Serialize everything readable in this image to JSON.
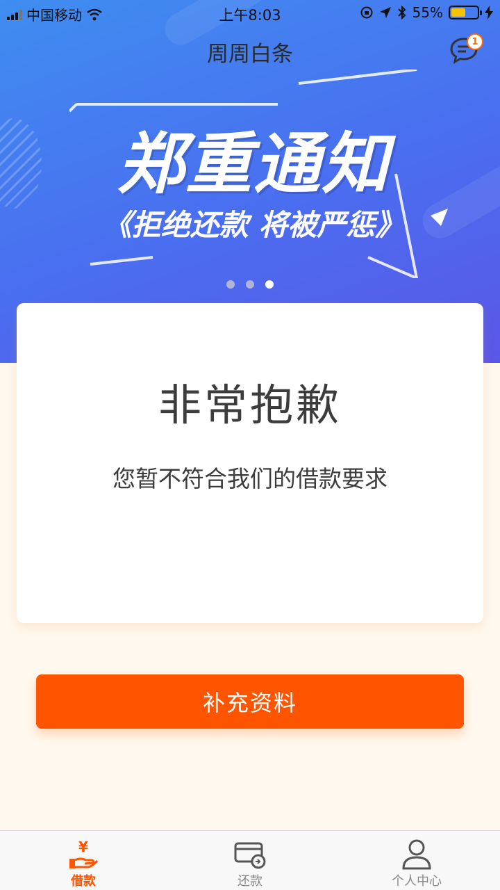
{
  "status_bar": {
    "carrier": "中国移动",
    "time": "上午8:03",
    "battery_percent": "55%",
    "battery_level": 0.55
  },
  "header": {
    "title": "周周白条",
    "message_badge": "1"
  },
  "banner": {
    "title": "郑重通知",
    "subtitle": "《拒绝还款 将被严惩》",
    "page_count": 3,
    "active_page": 3
  },
  "card": {
    "title": "非常抱歉",
    "message": "您暂不符合我们的借款要求"
  },
  "cta": {
    "label": "补充资料"
  },
  "tabbar": {
    "items": [
      {
        "label": "借款",
        "icon": "loan-hand-yen-icon",
        "active": true
      },
      {
        "label": "还款",
        "icon": "repay-card-icon",
        "active": false
      },
      {
        "label": "个人中心",
        "icon": "person-icon",
        "active": false
      }
    ]
  },
  "colors": {
    "accent": "#ff5500",
    "hero_gradient_start": "#3f8df0",
    "hero_gradient_end": "#5a57e6",
    "background": "#fff8ee"
  }
}
